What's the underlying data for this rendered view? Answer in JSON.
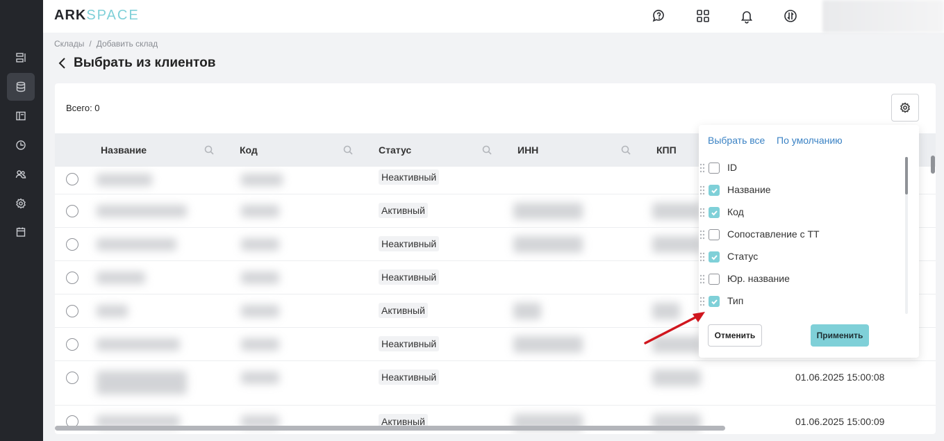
{
  "header": {
    "logo_part1": "ARK",
    "logo_part2": "SPACE",
    "icons": [
      "chat-question-icon",
      "grid-icon",
      "bell-icon",
      "exchange-icon"
    ]
  },
  "sidebar": {
    "items": [
      "list-icon",
      "database-icon",
      "layout-icon",
      "clock-icon",
      "users-icon",
      "gear-icon",
      "calendar-icon"
    ],
    "active": "database-icon"
  },
  "breadcrumb": {
    "items": [
      "Склады",
      "Добавить склад"
    ],
    "separator": "/"
  },
  "page": {
    "title": "Выбрать из клиентов"
  },
  "table": {
    "total": "Всего: 0",
    "columns": [
      "Название",
      "Код",
      "Статус",
      "ИНН",
      "КПП"
    ],
    "rows": [
      {
        "status": "Неактивный",
        "date": ""
      },
      {
        "status": "Активный",
        "date": ""
      },
      {
        "status": "Неактивный",
        "date": ""
      },
      {
        "status": "Неактивный",
        "date": ""
      },
      {
        "status": "Активный",
        "date": ""
      },
      {
        "status": "Неактивный",
        "date": ""
      },
      {
        "status": "Неактивный",
        "date": "01.06.2025 15:00:08"
      },
      {
        "status": "Активный",
        "date": "01.06.2025 15:00:09"
      }
    ]
  },
  "column_settings": {
    "select_all": "Выбрать все",
    "default": "По умолчанию",
    "items": [
      {
        "label": "ID",
        "checked": false
      },
      {
        "label": "Название",
        "checked": true
      },
      {
        "label": "Код",
        "checked": true
      },
      {
        "label": "Сопоставление с ТТ",
        "checked": false
      },
      {
        "label": "Статус",
        "checked": true
      },
      {
        "label": "Юр. название",
        "checked": false
      },
      {
        "label": "Тип",
        "checked": true
      }
    ],
    "cancel": "Отменить",
    "apply": "Применить"
  },
  "colors": {
    "accent": "#7fd0d8",
    "link": "#3a82c4",
    "sidebar": "#24262b",
    "arrow": "#d0161e"
  }
}
